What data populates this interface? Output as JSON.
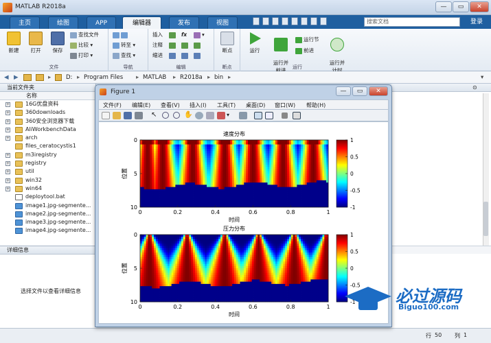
{
  "app": {
    "title": "MATLAB R2018a",
    "min": "—",
    "max": "▭",
    "close": "✕"
  },
  "tabs": [
    "主页",
    "绘图",
    "APP",
    "编辑器",
    "发布",
    "视图"
  ],
  "search": {
    "placeholder": "搜索文档"
  },
  "login": "登录",
  "ribbon": {
    "file": {
      "label": "文件",
      "new": "新建",
      "open": "打开",
      "save": "保存",
      "find": "查找文件",
      "compare": "比较",
      "print": "打印"
    },
    "nav": {
      "label": "导航",
      "goto": "转至",
      "find": "查找"
    },
    "edit": {
      "label": "编辑",
      "insert": "插入",
      "comment": "注释",
      "indent": "缩进",
      "fx": "fx"
    },
    "breakpoint": {
      "label": "断点",
      "btn": "断点"
    },
    "run": {
      "label": "运行",
      "run": "运行",
      "run_advance": "运行并\n前进",
      "run_section": "运行节",
      "advance": "前进",
      "run_time": "运行并\n计时"
    }
  },
  "breadcrumb": [
    "D:",
    "Program Files",
    "MATLAB",
    "R2018a",
    "bin"
  ],
  "current_folder": {
    "title": "当前文件夹",
    "col_name": "名称",
    "items": [
      {
        "name": "16G优盘资料",
        "type": "folder",
        "expand": "+"
      },
      {
        "name": "360downloads",
        "type": "folder",
        "expand": "+"
      },
      {
        "name": "360安全浏览器下载",
        "type": "folder",
        "expand": "+"
      },
      {
        "name": "AliWorkbenchData",
        "type": "folder",
        "expand": "+"
      },
      {
        "name": "arch",
        "type": "folder",
        "expand": "+"
      },
      {
        "name": "files_ceratocystis1",
        "type": "folder",
        "expand": ""
      },
      {
        "name": "m3iregistry",
        "type": "folder",
        "expand": "+"
      },
      {
        "name": "registry",
        "type": "folder",
        "expand": "+"
      },
      {
        "name": "util",
        "type": "folder",
        "expand": "+"
      },
      {
        "name": "win32",
        "type": "folder",
        "expand": "+"
      },
      {
        "name": "win64",
        "type": "folder",
        "expand": "+"
      },
      {
        "name": "deploytool.bat",
        "type": "bat",
        "expand": ""
      },
      {
        "name": "image1.jpg-segmente...",
        "type": "image",
        "expand": ""
      },
      {
        "name": "image2.jpg-segmente...",
        "type": "image",
        "expand": ""
      },
      {
        "name": "image3.jpg-segmente...",
        "type": "image",
        "expand": ""
      },
      {
        "name": "image4.jpg-segmente...",
        "type": "image",
        "expand": ""
      }
    ]
  },
  "details": {
    "title": "详细信息",
    "hint": "选择文件以查看详细信息"
  },
  "status": {
    "row_label": "行",
    "row": "50",
    "col_label": "列",
    "col": "1"
  },
  "figure": {
    "title": "Figure 1",
    "menu": [
      "文件(F)",
      "编辑(E)",
      "查看(V)",
      "插入(I)",
      "工具(T)",
      "桌面(D)",
      "窗口(W)",
      "帮助(H)"
    ]
  },
  "watermark": {
    "cn": "必过源码",
    "en": "Biguo100.com"
  },
  "colors": {
    "accent": "#1f5fa0",
    "tab_active": "#f0f4f8",
    "watermark": "#1c6cc4"
  },
  "chart_data": [
    {
      "type": "heatmap",
      "title": "速度分布",
      "xlabel": "时间",
      "ylabel": "位置",
      "xlim": [
        0,
        1
      ],
      "ylim": [
        0,
        10
      ],
      "y_reversed": true,
      "xticks": [
        "0",
        "0.2",
        "0.4",
        "0.6",
        "0.8",
        "1"
      ],
      "yticks": [
        "0",
        "5",
        "10"
      ],
      "colorbar": {
        "range": [
          -1,
          1
        ],
        "ticks": [
          "1",
          "0.5",
          "0",
          "-0.5",
          "-1"
        ]
      },
      "colormap": "jet",
      "pattern": {
        "peaks_x": [
          0.04,
          0.12,
          0.28,
          0.45,
          0.6,
          0.76,
          0.92
        ],
        "front_depth": [
          7.0,
          6.5
        ]
      }
    },
    {
      "type": "heatmap",
      "title": "压力分布",
      "xlabel": "时间",
      "ylabel": "位置",
      "xlim": [
        0,
        1
      ],
      "ylim": [
        0,
        10
      ],
      "y_reversed": true,
      "xticks": [
        "0",
        "0.2",
        "0.4",
        "0.6",
        "0.8",
        "1"
      ],
      "yticks": [
        "0",
        "5",
        "10"
      ],
      "colorbar": {
        "range": [
          -1,
          1
        ],
        "ticks": [
          "1",
          "0.5",
          "0",
          "-0.5",
          "-1"
        ]
      },
      "colormap": "jet",
      "pattern": {
        "peaks_x": [
          0.05,
          0.25,
          0.45,
          0.63,
          0.82,
          0.99
        ],
        "front_depth": [
          7.5,
          7.0
        ]
      }
    }
  ]
}
